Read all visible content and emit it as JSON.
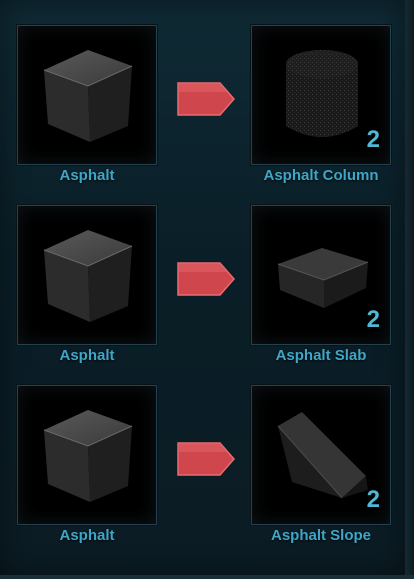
{
  "recipes": [
    {
      "input": {
        "name": "Asphalt",
        "icon": "asphalt-cube-icon"
      },
      "output": {
        "name": "Asphalt Column",
        "count": "2",
        "icon": "asphalt-column-icon"
      },
      "arrow_icon": "arrow-right-icon"
    },
    {
      "input": {
        "name": "Asphalt",
        "icon": "asphalt-cube-icon"
      },
      "output": {
        "name": "Asphalt Slab",
        "count": "2",
        "icon": "asphalt-slab-icon"
      },
      "arrow_icon": "arrow-right-icon"
    },
    {
      "input": {
        "name": "Asphalt",
        "icon": "asphalt-cube-icon"
      },
      "output": {
        "name": "Asphalt Slope",
        "count": "2",
        "icon": "asphalt-slope-icon"
      },
      "arrow_icon": "arrow-right-icon"
    }
  ],
  "colors": {
    "label": "#3fa6c7",
    "count": "#4fb8d6",
    "arrow": "#d2474d",
    "panel": "#0f2a35"
  }
}
